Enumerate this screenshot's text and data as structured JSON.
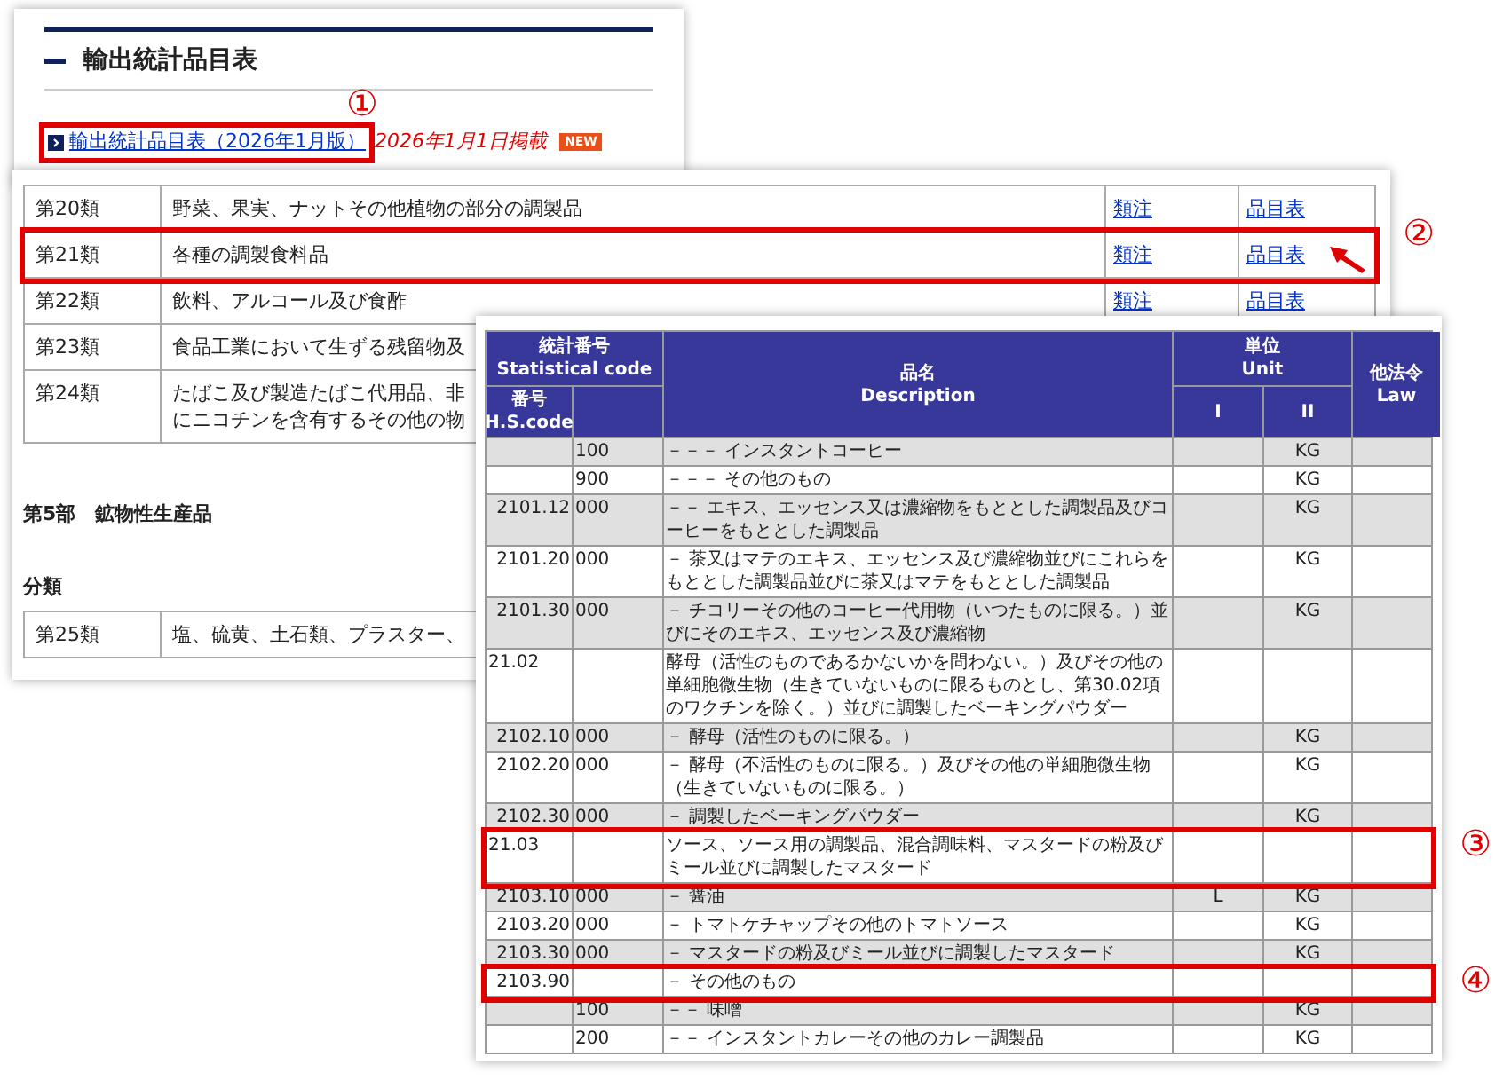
{
  "page_panel": {
    "title": "輸出統計品目表",
    "link": {
      "text": "輸出統計品目表（2026年1月版）",
      "annotation": "①"
    },
    "date": "2026年1月1日掲載",
    "badge": "NEW"
  },
  "chapter_panel": {
    "rows": [
      {
        "chapter": "第20類",
        "title": "野菜、果実、ナットその他植物の部分の調製品",
        "note_link": "類注",
        "list_link": "品目表"
      },
      {
        "chapter": "第21類",
        "title": "各種の調製食料品",
        "note_link": "類注",
        "list_link": "品目表",
        "annotation": "②"
      },
      {
        "chapter": "第22類",
        "title": "飲料、アルコール及び食酢",
        "note_link": "類注",
        "list_link": "品目表"
      },
      {
        "chapter": "第23類",
        "title": "食品工業において生ずる残留物及"
      },
      {
        "chapter": "第24類",
        "title_lines": [
          "たばこ及び製造たばこ代用品、非",
          "にニコチンを含有するその他の物"
        ]
      }
    ],
    "section_heading": "第5部　鉱物性生産品",
    "subheading": "分類",
    "rows_after": [
      {
        "chapter": "第25類",
        "title": "塩、硫黄、土石類、プラスター、"
      }
    ]
  },
  "tariff_table": {
    "headers": {
      "code_group": "統計番号",
      "code_group_en": "Statistical code",
      "hs": "番号",
      "hs_en": "H.S.code",
      "desc": "品名",
      "desc_en": "Description",
      "unit": "単位",
      "unit_en": "Unit",
      "unit_1": "I",
      "unit_2": "II",
      "law": "他法令",
      "law_en": "Law"
    },
    "rows": [
      {
        "kind": "item",
        "code": "",
        "sub": "100",
        "description": "－－－ インスタントコーヒー",
        "unit_1": "",
        "unit_2": "KG"
      },
      {
        "kind": "item",
        "code": "",
        "sub": "900",
        "description": "－－－ その他のもの",
        "unit_1": "",
        "unit_2": "KG"
      },
      {
        "kind": "item",
        "code": "2101.12",
        "sub": "000",
        "description": "－－ エキス、エッセンス又は濃縮物をもととした調製品及びコーヒーをもととした調製品",
        "unit_1": "",
        "unit_2": "KG"
      },
      {
        "kind": "item",
        "code": "2101.20",
        "sub": "000",
        "description": "－ 茶又はマテのエキス、エッセンス及び濃縮物並びにこれらをもととした調製品並びに茶又はマテをもととした調製品",
        "unit_1": "",
        "unit_2": "KG"
      },
      {
        "kind": "item",
        "code": "2101.30",
        "sub": "000",
        "description": "－ チコリーその他のコーヒー代用物（いつたものに限る。）並びにそのエキス、エッセンス及び濃縮物",
        "unit_1": "",
        "unit_2": "KG"
      },
      {
        "kind": "heading",
        "code": "21.02",
        "sub": "",
        "description": "酵母（活性のものであるかないかを問わない。）及びその他の単細胞微生物（生きていないものに限るものとし、第30.02項のワクチンを除く。）並びに調製したベーキングパウダー",
        "unit_1": "",
        "unit_2": ""
      },
      {
        "kind": "item",
        "code": "2102.10",
        "sub": "000",
        "description": "－ 酵母（活性のものに限る。）",
        "unit_1": "",
        "unit_2": "KG"
      },
      {
        "kind": "item",
        "code": "2102.20",
        "sub": "000",
        "description": "－ 酵母（不活性のものに限る。）及びその他の単細胞微生物（生きていないものに限る。）",
        "unit_1": "",
        "unit_2": "KG"
      },
      {
        "kind": "item",
        "code": "2102.30",
        "sub": "000",
        "description": "－ 調製したベーキングパウダー",
        "unit_1": "",
        "unit_2": "KG"
      },
      {
        "kind": "heading",
        "code": "21.03",
        "sub": "",
        "description": "ソース、ソース用の調製品、混合調味料、マスタードの粉及びミール並びに調製したマスタード",
        "unit_1": "",
        "unit_2": "",
        "annotation": "③"
      },
      {
        "kind": "item",
        "code": "2103.10",
        "sub": "000",
        "description": "－ 醤油",
        "unit_1": "L",
        "unit_2": "KG"
      },
      {
        "kind": "item",
        "code": "2103.20",
        "sub": "000",
        "description": "－ トマトケチャップその他のトマトソース",
        "unit_1": "",
        "unit_2": "KG"
      },
      {
        "kind": "item",
        "code": "2103.30",
        "sub": "000",
        "description": "－ マスタードの粉及びミール並びに調製したマスタード",
        "unit_1": "",
        "unit_2": "KG"
      },
      {
        "kind": "item",
        "code": "2103.90",
        "sub": "",
        "description": "－ その他のもの",
        "unit_1": "",
        "unit_2": "",
        "annotation": "④"
      },
      {
        "kind": "item",
        "code": "",
        "sub": "100",
        "description": "－－ 味噌",
        "unit_1": "",
        "unit_2": "KG"
      },
      {
        "kind": "item",
        "code": "",
        "sub": "200",
        "description": "－－ インスタントカレーその他のカレー調製品",
        "unit_1": "",
        "unit_2": "KG"
      }
    ]
  }
}
